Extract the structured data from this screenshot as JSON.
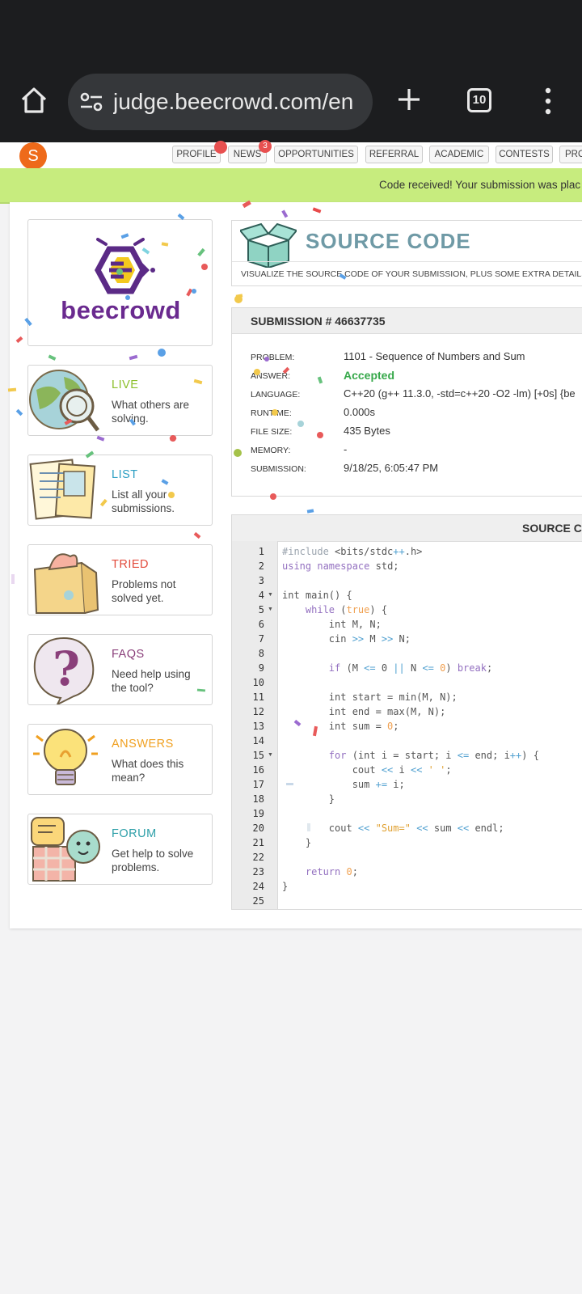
{
  "browser": {
    "url": "judge.beecrowd.com/en",
    "tab_count": "10"
  },
  "nav": {
    "avatar_letter": "S",
    "items": [
      "PROFILE",
      "NEWS",
      "OPPORTUNITIES",
      "REFERRAL",
      "ACADEMIC",
      "CONTESTS",
      "PRO"
    ],
    "news_badge": "3"
  },
  "notice": "Code received! Your submission was plac",
  "logo": {
    "text": "beecrowd"
  },
  "sidebar": [
    {
      "title": "LIVE",
      "desc": "What others are solving.",
      "color": "#8bbf2a"
    },
    {
      "title": "LIST",
      "desc": "List all your submissions.",
      "color": "#2d9fc3"
    },
    {
      "title": "TRIED",
      "desc": "Problems not solved yet.",
      "color": "#e24a3b"
    },
    {
      "title": "FAQS",
      "desc": "Need help using the tool?",
      "color": "#8a3f7a"
    },
    {
      "title": "ANSWERS",
      "desc": "What does this mean?",
      "color": "#f0a020"
    },
    {
      "title": "FORUM",
      "desc": "Get help to solve problems.",
      "color": "#2d9fa8"
    }
  ],
  "source_header": {
    "title": "SOURCE CODE",
    "subtitle": "VISUALIZE THE SOURCE CODE OF YOUR SUBMISSION, PLUS SOME EXTRA DETAILS"
  },
  "submission": {
    "heading": "SUBMISSION # 46637735",
    "rows": [
      {
        "label": "PROBLEM:",
        "value": "1101 - Sequence of Numbers and Sum"
      },
      {
        "label": "ANSWER:",
        "value": "Accepted"
      },
      {
        "label": "LANGUAGE:",
        "value": "C++20 (g++ 11.3.0, -std=c++20 -O2 -lm) [+0s] {be"
      },
      {
        "label": "RUNTIME:",
        "value": "0.000s"
      },
      {
        "label": "FILE SIZE:",
        "value": "435 Bytes"
      },
      {
        "label": "MEMORY:",
        "value": "-"
      },
      {
        "label": "SUBMISSION:",
        "value": "9/18/25, 6:05:47 PM"
      }
    ]
  },
  "code_panel": {
    "heading": "SOURCE CO",
    "lines": [
      "#include <bits/stdc++.h>",
      "using namespace std;",
      "",
      "int main() {",
      "    while (true) {",
      "        int M, N;",
      "        cin >> M >> N;",
      "",
      "        if (M <= 0 || N <= 0) break;",
      "",
      "        int start = min(M, N);",
      "        int end = max(M, N);",
      "        int sum = 0;",
      "",
      "        for (int i = start; i <= end; i++) {",
      "            cout << i << ' ';",
      "            sum += i;",
      "        }",
      "",
      "        cout << \"Sum=\" << sum << endl;",
      "    }",
      "",
      "    return 0;",
      "}",
      ""
    ],
    "fold_lines": [
      4,
      5,
      15
    ]
  }
}
